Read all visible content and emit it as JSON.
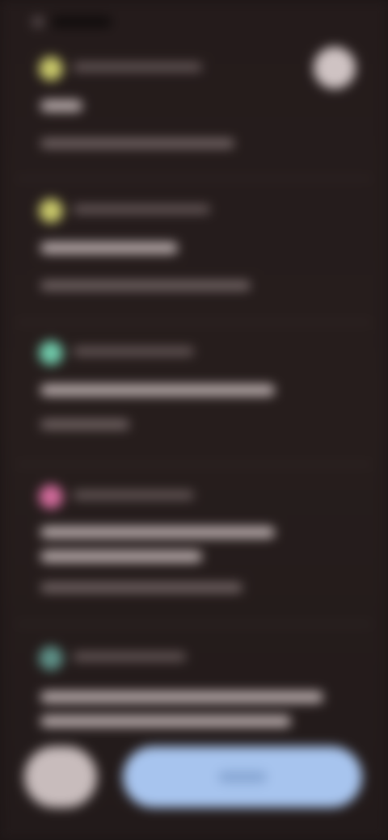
{
  "colors": {
    "background": "#241b1b",
    "card_title": "#bdb0b0",
    "card_meta": "#6c5e5e",
    "accent_yellow": "#c9c86a",
    "accent_green": "#6fc9a9",
    "accent_pink": "#d06a9a",
    "accent_teal": "#5d8f86",
    "primary_button": "#a7c4ee"
  },
  "icons": {
    "top_left_status": "dot-icon",
    "top_right_avatar": "avatar-icon"
  },
  "items": [
    {
      "dot_color": "#c9c86a"
    },
    {
      "dot_color": "#c9c86a"
    },
    {
      "dot_color": "#6fc9a9"
    },
    {
      "dot_color": "#d06a9a"
    },
    {
      "dot_color": "#5d8f86"
    }
  ]
}
